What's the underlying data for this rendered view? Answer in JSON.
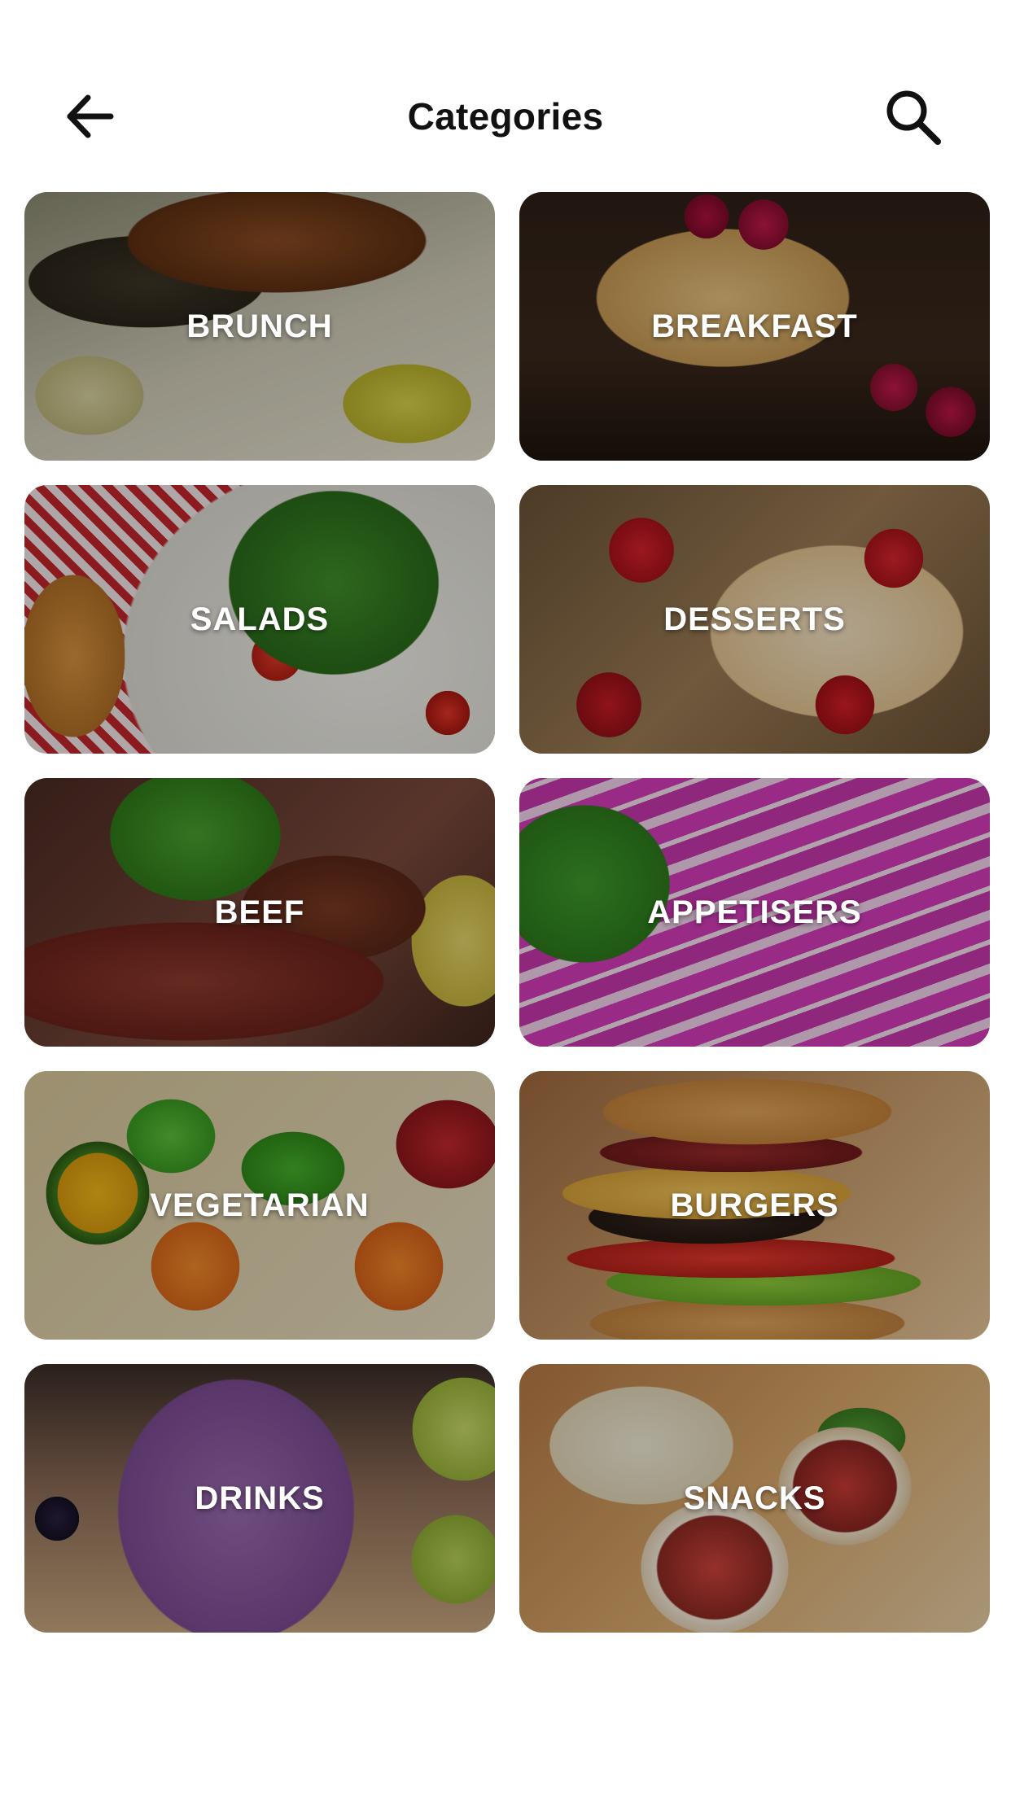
{
  "header": {
    "title": "Categories",
    "back_icon": "arrow-left-icon",
    "search_icon": "search-icon"
  },
  "categories": [
    {
      "label": "BRUNCH"
    },
    {
      "label": "BREAKFAST"
    },
    {
      "label": "SALADS"
    },
    {
      "label": "DESSERTS"
    },
    {
      "label": "BEEF"
    },
    {
      "label": "APPETISERS"
    },
    {
      "label": "VEGETARIAN"
    },
    {
      "label": "BURGERS"
    },
    {
      "label": "DRINKS"
    },
    {
      "label": "SNACKS"
    }
  ]
}
